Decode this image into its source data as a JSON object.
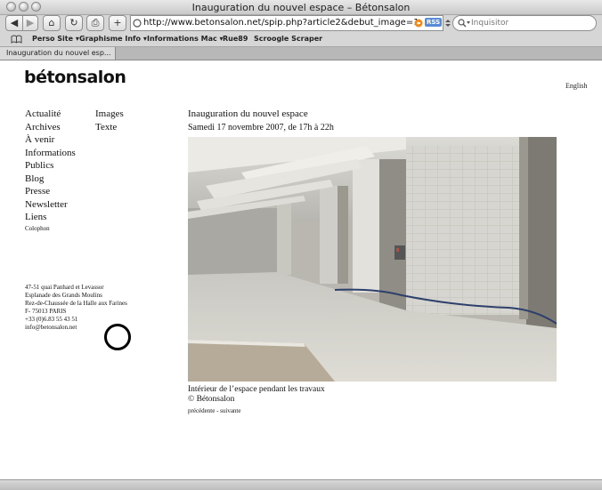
{
  "window": {
    "title": "Inauguration du nouvel espace – Bétonsalon"
  },
  "toolbar": {
    "back": "◀",
    "forward": "▶",
    "home": "⌂",
    "reload": "↻",
    "print": "⎙",
    "add": "+",
    "url": "http://www.betonsalon.net/spip.php?article2&debut_image=1",
    "rss_label": "RSS",
    "search_placeholder": "Inquisitor"
  },
  "bookmarks": {
    "icon": "book-icon",
    "items": [
      {
        "label": "Perso Site ▾"
      },
      {
        "label": "Graphisme Info ▾"
      },
      {
        "label": "Informations Mac ▾"
      },
      {
        "label": "Rue89"
      },
      {
        "label": "Scroogle Scraper"
      }
    ]
  },
  "tabs": [
    {
      "label": "Inauguration du nouvel esp..."
    }
  ],
  "site": {
    "logo": "bétonsalon",
    "language_link": "English",
    "nav": [
      {
        "label": "Actualité"
      },
      {
        "label": "Archives"
      },
      {
        "label": "À venir"
      },
      {
        "label": "Informations"
      },
      {
        "label": "Publics"
      },
      {
        "label": "Blog"
      },
      {
        "label": "Presse"
      },
      {
        "label": "Newsletter"
      },
      {
        "label": "Liens"
      },
      {
        "label": "Colophon"
      }
    ],
    "subnav": [
      {
        "label": "Images"
      },
      {
        "label": "Texte"
      }
    ],
    "address": [
      "47-51 quai Panhard et Levassor",
      "Esplanade des Grands Moulins",
      "Rez-de-Chaussée de la Halle aux Farines",
      "F- 75013 PARIS",
      "+33 (0)6.83 55 43 51",
      "info@betonsalon.net"
    ]
  },
  "article": {
    "title": "Inauguration du nouvel espace",
    "date": "Samedi 17 novembre 2007, de 17h à 22h",
    "caption_line1": "Intérieur de l’espace pendant les travaux",
    "caption_line2": "© Bétonsalon",
    "prev_label": "précédente",
    "separator": " - ",
    "next_label": "suivante"
  }
}
